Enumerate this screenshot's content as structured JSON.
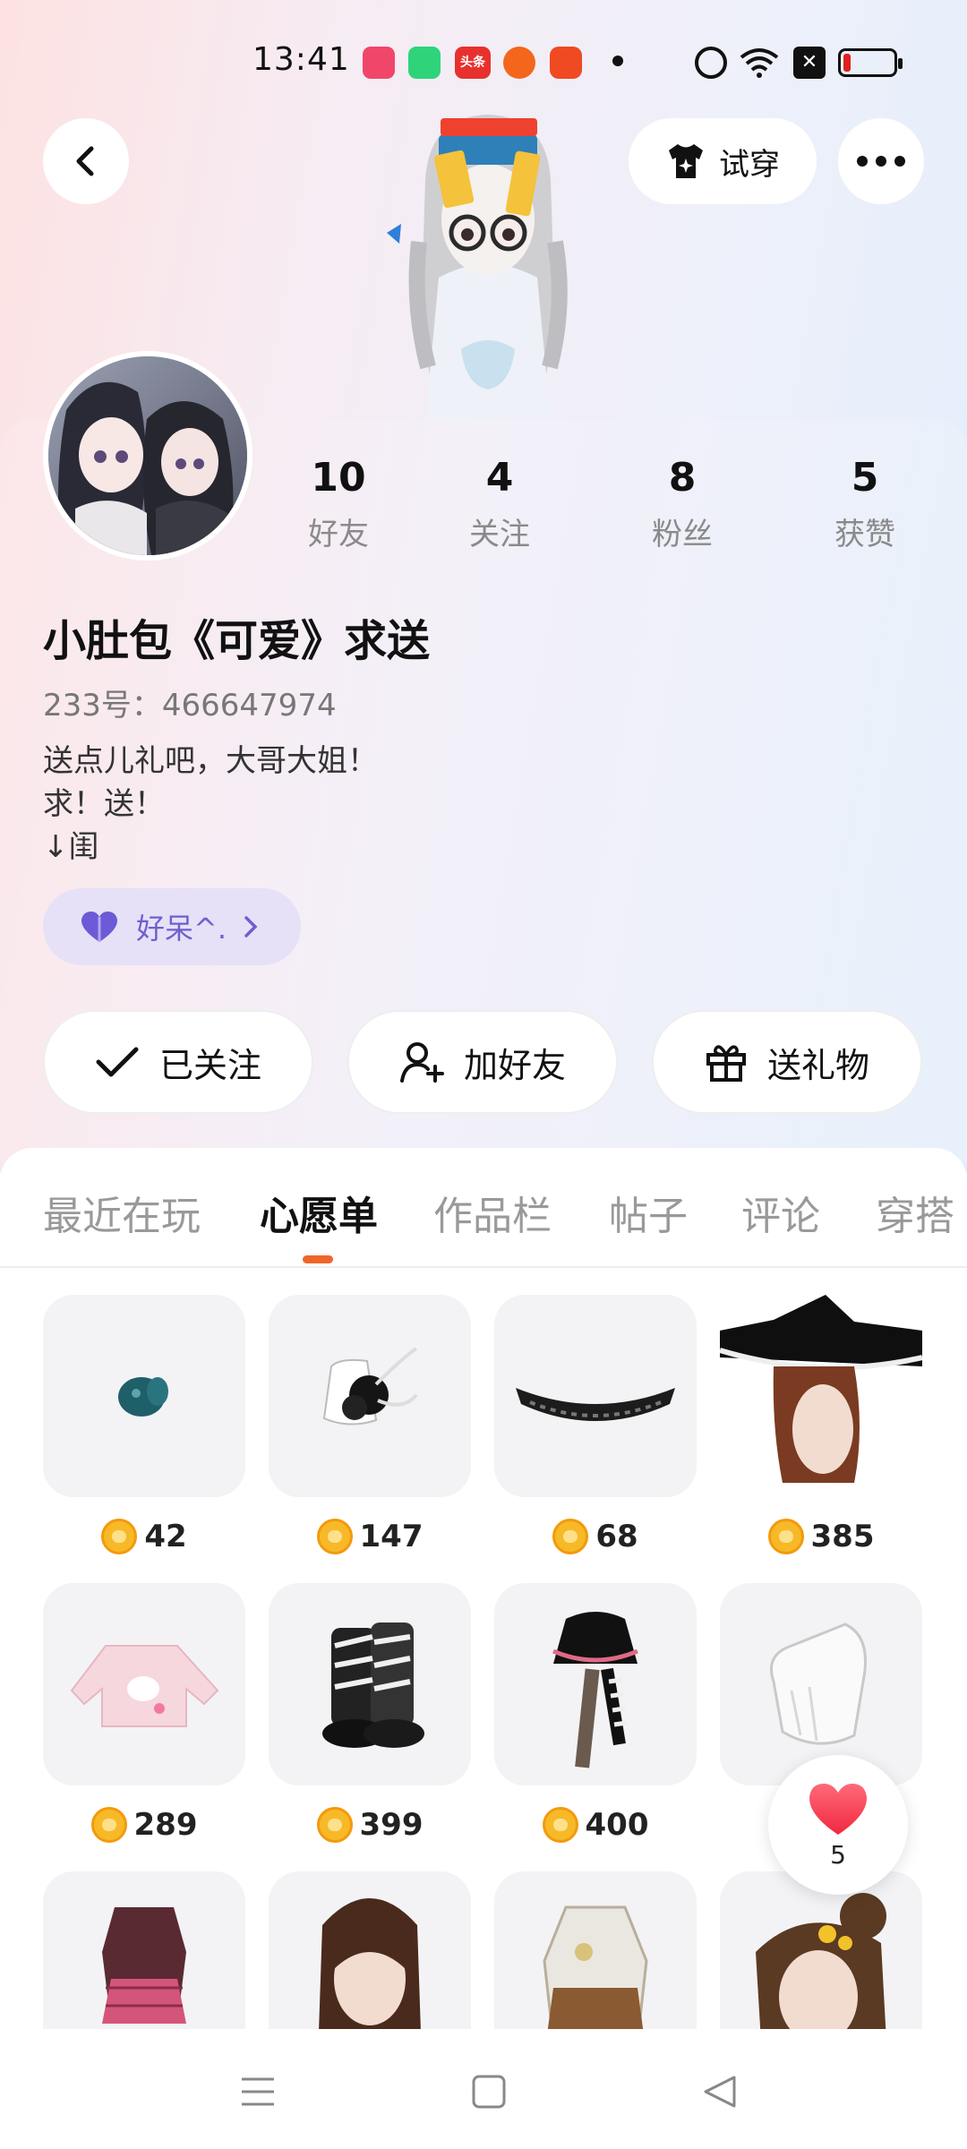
{
  "status_bar": {
    "time": "13:41",
    "icons": [
      "music-app-icon",
      "battery-app-icon",
      "toutiao-icon",
      "app-icon",
      "app-icon",
      "notification-dot",
      "alarm-icon",
      "wifi-icon",
      "x-app-icon",
      "battery-icon"
    ],
    "toutiao_label": "头条"
  },
  "header": {
    "try_on_label": "试穿"
  },
  "profile": {
    "name": "小肚包《可爱》求送",
    "uid": "233号：466647974",
    "bio": "送点儿礼吧，大哥大姐！\n求！送！\n↓闺",
    "tag_label": "好呆^.",
    "stats": [
      {
        "value": "10",
        "label": "好友"
      },
      {
        "value": "4",
        "label": "关注"
      },
      {
        "value": "8",
        "label": "粉丝"
      },
      {
        "value": "5",
        "label": "获赞"
      }
    ]
  },
  "actions": {
    "followed_label": "已关注",
    "add_friend_label": "加好友",
    "send_gift_label": "送礼物"
  },
  "tabs": [
    {
      "label": "最近在玩",
      "active": false
    },
    {
      "label": "心愿单",
      "active": true
    },
    {
      "label": "作品栏",
      "active": false
    },
    {
      "label": "帖子",
      "active": false
    },
    {
      "label": "评论",
      "active": false
    },
    {
      "label": "穿搭",
      "active": false
    }
  ],
  "wishlist": [
    {
      "name": "green-pacifier",
      "price": "42"
    },
    {
      "name": "white-black-flower-hairpin",
      "price": "147"
    },
    {
      "name": "black-lace-choker",
      "price": "68"
    },
    {
      "name": "witch-hat-hair",
      "price": "385"
    },
    {
      "name": "pink-bunny-sweater",
      "price": "289"
    },
    {
      "name": "zebra-boots",
      "price": "399"
    },
    {
      "name": "black-skirt-stockings",
      "price": "400"
    },
    {
      "name": "white-gloves",
      "price": ""
    },
    {
      "name": "pink-plaid-outfit",
      "price": ""
    },
    {
      "name": "brown-bun-hair",
      "price": ""
    },
    {
      "name": "brown-white-dress",
      "price": ""
    },
    {
      "name": "brown-flower-bun-hair",
      "price": ""
    }
  ],
  "like_button": {
    "count": "5"
  },
  "colors": {
    "accent": "#f0662a",
    "tag_bg": "#e6e1f7",
    "tag_text": "#6f5fcf",
    "coin": "#f7b928"
  }
}
